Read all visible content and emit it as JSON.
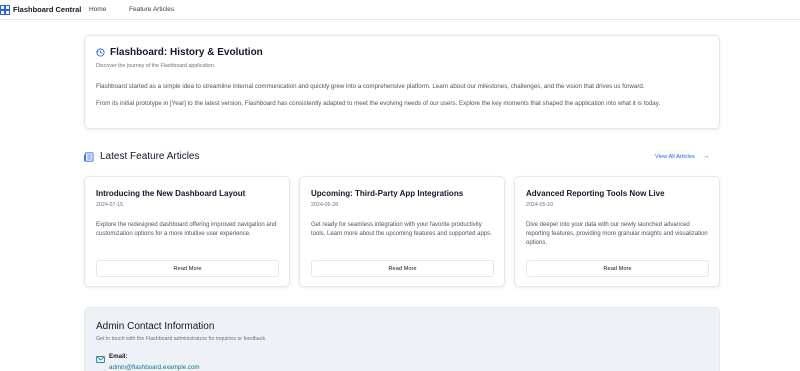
{
  "navbar": {
    "brand": "Flashboard Central",
    "links": [
      "Home",
      "Feature Articles"
    ]
  },
  "history": {
    "title": "Flashboard: History & Evolution",
    "subtitle": "Discover the journey of the Flashboard application.",
    "paragraph1": "Flashboard started as a simple idea to streamline internal communication and quickly grew into a comprehensive platform. Learn about our milestones, challenges, and the vision that drives us forward.",
    "paragraph2": "From its initial prototype in [Year] to the latest version, Flashboard has consistently adapted to meet the evolving needs of our users. Explore the key moments that shaped the application into what it is today."
  },
  "latest": {
    "title": "Latest Feature Articles",
    "view_all": "View All Articles",
    "articles": [
      {
        "title": "Introducing the New Dashboard Layout",
        "date": "2024-07-15",
        "description": "Explore the redesigned dashboard offering improved navigation and customization options for a more intuitive user experience.",
        "button": "Read More"
      },
      {
        "title": "Upcoming: Third-Party App Integrations",
        "date": "2024-06-28",
        "description": "Get ready for seamless integration with your favorite productivity tools. Learn more about the upcoming features and supported apps.",
        "button": "Read More"
      },
      {
        "title": "Advanced Reporting Tools Now Live",
        "date": "2024-05-10",
        "description": "Dive deeper into your data with our newly launched advanced reporting features, providing more granular insights and visualization options.",
        "button": "Read More"
      }
    ]
  },
  "admin": {
    "title": "Admin Contact Information",
    "subtitle": "Get in touch with the Flashboard administrators for inquiries or feedback.",
    "email_label": "Email:",
    "email_value": "admin@flashboard.example.com"
  },
  "colors": {
    "accent": "#2563eb",
    "link": "#0e7490",
    "admin_bg": "#eef2f7"
  }
}
